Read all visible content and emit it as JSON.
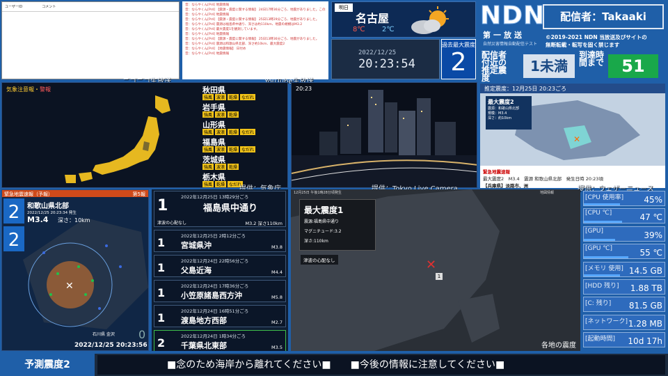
{
  "comments": {
    "col1": "ユーザーID",
    "col2": "コメント",
    "source_label": "ニコニコ生放送"
  },
  "youtube": {
    "lines": [
      "音：ならやくん[Pr4] 地震情報",
      "音：ならやくん[Pr4] 【震源・震度に関する情報】 24日17時36分ごろ、地震がありました。この地震による津波の心配はありません。",
      "音：ならやくん[Pr4] 地震情報",
      "音：ならやくん[Pr4] 【震源・震度に関する情報】 25日13時29分ごろ、地震がありました。",
      "音：ならやくん[Pr4] 震源は福島県中通り、深さは約110km、地震の規模はM3.2",
      "音：ならやくん[Pr4] 最大震度1を観測しています。",
      "音：ならやくん[Pr4] 地震情報",
      "音：ならやくん[Pr4] 【震源・震度に関する情報】 25日13時36分ごろ、地震がありました。",
      "音：ならやくん[Pr4] 震源は和歌山県北部、深さ約10km、最大震度2",
      "音：ならやくん[Pr4] 【地震情報】 日付め",
      "音：ならやくん[Pr4] 地震情報"
    ],
    "source_label": "YouTube生放送"
  },
  "weather": {
    "day": "明日",
    "city": "名古屋",
    "high": "8℃",
    "low": "2℃"
  },
  "clock": {
    "date": "2022/12/25",
    "time": "20:23:54"
  },
  "max_intensity": {
    "label": "過去最大震度",
    "value": "2"
  },
  "ndn": {
    "logo": "NDN",
    "distributor": "配信者：Takaaki",
    "sub1": "第一放送",
    "sub2": "自然災害情報自動配信テスト",
    "copyright_1": "©2019-2021 NDN 当放送及びサイトの",
    "copyright_2": "無断転載・転写を固く禁じます",
    "est_label": "配信者付近の推定震度",
    "est_value": "1未満",
    "arrival_label": "到達時間まで",
    "arrival_value": "51"
  },
  "warnings": {
    "title": "気象注意報・",
    "title_red": "警報",
    "source_label": "提供：気象庁",
    "prefectures": [
      {
        "name": "秋田県",
        "tags": [
          "強風",
          "波浪",
          "乾燥",
          "なだれ"
        ]
      },
      {
        "name": "岩手県",
        "tags": [
          "強風",
          "波浪",
          "乾燥"
        ]
      },
      {
        "name": "山形県",
        "tags": [
          "強風",
          "波浪",
          "乾燥",
          "なだれ"
        ]
      },
      {
        "name": "福島県",
        "tags": [
          "強風",
          "波浪",
          "乾燥",
          "なだれ"
        ]
      },
      {
        "name": "茨城県",
        "tags": [
          "強風",
          "波浪",
          "乾燥"
        ]
      },
      {
        "name": "栃木県",
        "tags": [
          "強風",
          "乾燥",
          "なだれ"
        ]
      }
    ]
  },
  "camera": {
    "time": "20:23",
    "source_label": "提供：Tokyo Live Camera"
  },
  "quakeinfo": {
    "header": "推定震度：12月25日 20:23ごろ",
    "max": "最大震度2",
    "l1": "震源：和歌山県北部",
    "l2": "規模：M3.4",
    "l3": "深さ：約10km",
    "foot1": "緊急地震速報",
    "foot2": "最大震度2　M3.4　震源 和歌山県北部　発生日時 20:23頃",
    "foot3": "【兵庫県】淡路市、洲",
    "source_label": "提供：ウェザーニュース"
  },
  "eew": {
    "header": "緊急地震速報（予報）",
    "serial": "第5報",
    "intensity1": "2",
    "intensity2": "2",
    "area": "和歌山県北部",
    "datetime": "2022/12/25 20:23:34 発生",
    "mag": "M3.4",
    "depth": "深さ：10km",
    "stamp": "2022/12/25 20:23:56",
    "station": "石川県 金沢",
    "zero": "0"
  },
  "quake_list": [
    {
      "scale": "1",
      "date": "2022年12月25日 13時29分ごろ",
      "place": "福島県中通り",
      "mag": "M3.2 深さ110km",
      "note": "津波の心配なし"
    },
    {
      "scale": "1",
      "date": "2022年12月25日 2時12分ごろ",
      "place": "宮城県沖",
      "mag": "M3.8"
    },
    {
      "scale": "1",
      "date": "2022年12月24日 22時56分ごろ",
      "place": "父島近海",
      "mag": "M4.4"
    },
    {
      "scale": "1",
      "date": "2022年12月24日 17時36分ごろ",
      "place": "小笠原諸島西方沖",
      "mag": "M5.8"
    },
    {
      "scale": "1",
      "date": "2022年12月24日 16時51分ごろ",
      "place": "渡島地方西部",
      "mag": "M2.7"
    },
    {
      "scale": "2",
      "date": "2022年12月24日 1時34分ごろ",
      "place": "千葉県北東部",
      "mag": "M3.5"
    }
  ],
  "bigmap": {
    "timestamp": "12月25日 午後1時28分頃発生",
    "src": "地図情報",
    "title": "最大震度1",
    "l1": "震源:福島県中通り",
    "l2": "マグニチュード:3.2",
    "l3": "深さ:110km",
    "tsunami": "津波の心配なし",
    "bottom": "各地の震度",
    "marker": "1"
  },
  "stats": [
    {
      "key": "[CPU 使用率]",
      "value": "45%",
      "pct": 45
    },
    {
      "key": "[CPU ℃]",
      "value": "47 ℃",
      "pct": 47
    },
    {
      "key": "[GPU]",
      "value": "39%",
      "pct": 39
    },
    {
      "key": "[GPU ℃]",
      "value": "55 ℃",
      "pct": 55
    },
    {
      "key": "[メモリ 使用]",
      "value": "14.5 GB",
      "pct": 45
    },
    {
      "key": "[HDD 残り]",
      "value": "1.88 TB",
      "pct": 0
    },
    {
      "key": "[C: 残り]",
      "value": "81.5 GB",
      "pct": 0
    },
    {
      "key": "[ネットワーク]",
      "value": "1.28 MB",
      "pct": 0
    },
    {
      "key": "[起動時間]",
      "value": "10d 17h",
      "pct": 0
    }
  ],
  "banner": {
    "pred": "予測震度2",
    "msg": "■念のため海岸から離れてください■　　■今後の情報に注意してください■"
  }
}
